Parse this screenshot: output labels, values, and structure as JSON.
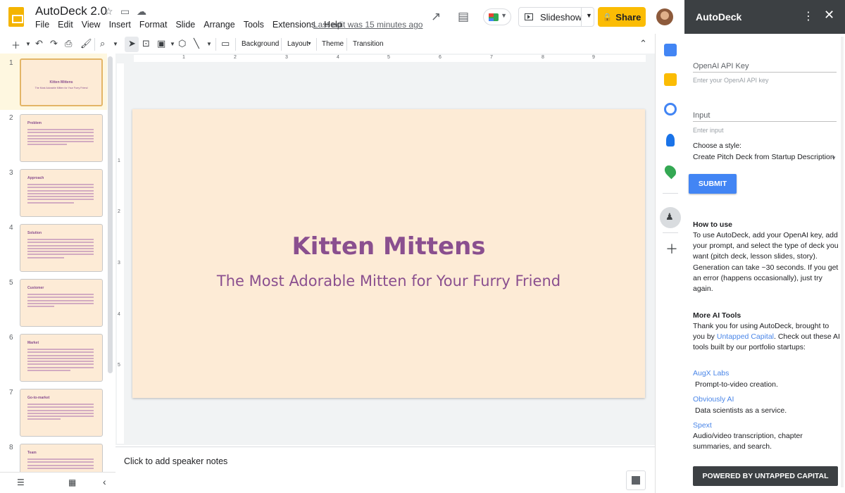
{
  "header": {
    "doc_title": "AutoDeck 2.0",
    "menu": [
      "File",
      "Edit",
      "View",
      "Insert",
      "Format",
      "Slide",
      "Arrange",
      "Tools",
      "Extensions",
      "Help"
    ],
    "last_edit": "Last edit was 15 minutes ago",
    "slideshow_label": "Slideshow",
    "share_label": "Share"
  },
  "toolbar": {
    "background_label": "Background",
    "layout_label": "Layout",
    "theme_label": "Theme",
    "transition_label": "Transition"
  },
  "filmstrip": {
    "slides": [
      {
        "num": "1",
        "title": "Kitten Mittens",
        "subtitle": "The Most Adorable Mitten for Your Furry Friend"
      },
      {
        "num": "2",
        "title": "Problem"
      },
      {
        "num": "3",
        "title": "Approach"
      },
      {
        "num": "4",
        "title": "Solution"
      },
      {
        "num": "5",
        "title": "Customer"
      },
      {
        "num": "6",
        "title": "Market"
      },
      {
        "num": "7",
        "title": "Go-to-market"
      },
      {
        "num": "8",
        "title": "Team"
      }
    ]
  },
  "slide": {
    "title": "Kitten Mittens",
    "subtitle": "The Most Adorable Mitten for Your Furry Friend"
  },
  "notes": {
    "placeholder": "Click to add speaker notes"
  },
  "ruler": {
    "h_ticks": [
      "1",
      "2",
      "3",
      "4",
      "5",
      "6",
      "7",
      "8",
      "9"
    ],
    "v_ticks": [
      "1",
      "2",
      "3",
      "4",
      "5"
    ]
  },
  "sidebar": {
    "title": "AutoDeck",
    "api_key_label": "OpenAI API Key",
    "api_key_placeholder": "Enter your OpenAI API key",
    "input_label": "Input",
    "input_placeholder": "Enter input",
    "style_label": "Choose a style:",
    "style_value": "Create Pitch Deck from Startup Description",
    "submit_label": "SUBMIT",
    "how_title": "How to use",
    "how_text": "To use AutoDeck, add your OpenAI key, add your prompt, and select the type of deck you want (pitch deck, lesson slides, story). Generation can take ~30 seconds. If you get an error (happens occasionally), just try again.",
    "more_title": "More AI Tools",
    "more_text_1": "Thank you for using AutoDeck, brought to you by ",
    "more_link": "Untapped Capital",
    "more_text_2": ". Check out these AI tools built by our portfolio startups:",
    "tools": [
      {
        "name": "AugX Labs",
        "desc": "Prompt-to-video creation."
      },
      {
        "name": "Obviously AI",
        "desc": "Data scientists as a service."
      },
      {
        "name": "Spext",
        "desc": "Audio/video transcription, chapter summaries, and search."
      }
    ],
    "powered_label": "POWERED BY UNTAPPED CAPITAL"
  },
  "colors": {
    "slide_bg": "#fdebd6",
    "slide_text": "#8a4f8f",
    "share_button": "#fbbc04",
    "submit_button": "#4285f4",
    "sidebar_header": "#3c4043"
  }
}
